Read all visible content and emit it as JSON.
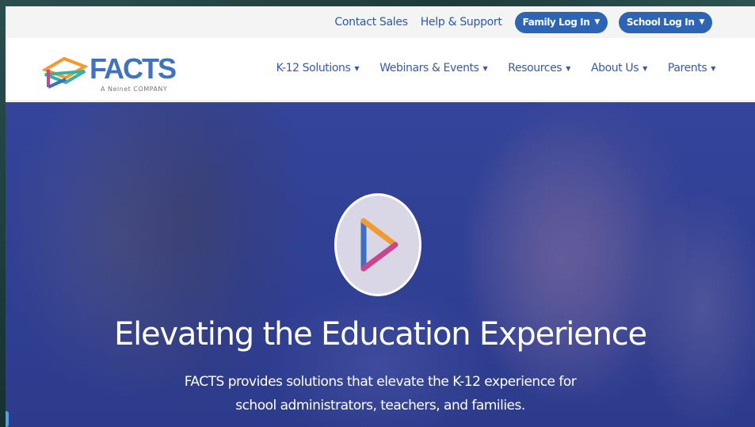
{
  "utility": {
    "contact_sales": "Contact Sales",
    "help_support": "Help & Support",
    "family_login": "Family Log In",
    "school_login": "School Log In"
  },
  "logo": {
    "name": "FACTS",
    "tagline": "A Nelnet COMPANY"
  },
  "nav": {
    "items": [
      {
        "label": "K-12 Solutions"
      },
      {
        "label": "Webinars & Events"
      },
      {
        "label": "Resources"
      },
      {
        "label": "About Us"
      },
      {
        "label": "Parents"
      }
    ],
    "caret": "▼"
  },
  "hero": {
    "title": "Elevating the Education Experience",
    "subtitle_line1": "FACTS provides solutions that elevate the K-12 experience for",
    "subtitle_line2": "school administrators, teachers, and families."
  },
  "colors": {
    "brand_blue": "#2e64b4",
    "hero_bg": "#33439a",
    "link": "#2a5aa8",
    "play_orange": "#f29a2e",
    "play_blue": "#3a6fc4",
    "play_pink": "#c9468f"
  }
}
